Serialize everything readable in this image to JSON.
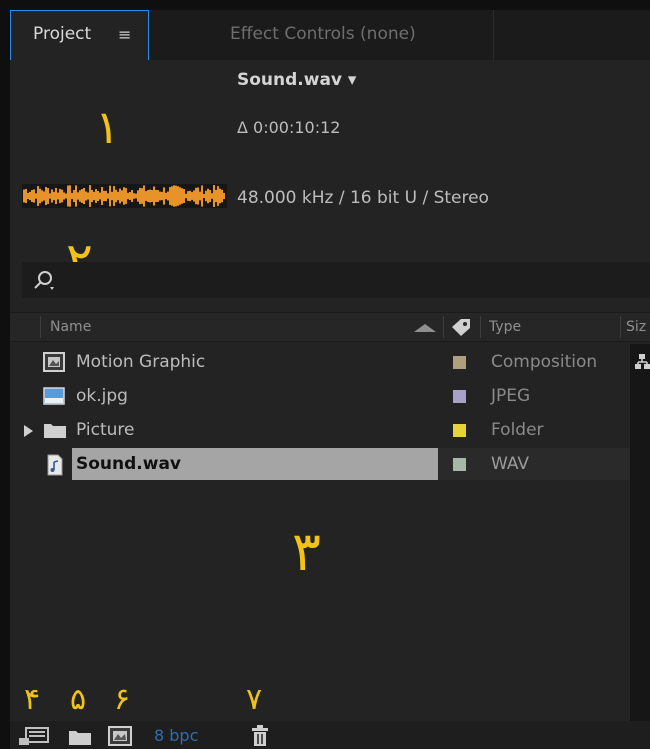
{
  "tabs": {
    "project_label": "Project",
    "menu_glyph": "≡",
    "effect_controls_label": "Effect Controls (none)"
  },
  "preview": {
    "file_title": "Sound.wav ▾",
    "duration": "Δ 0:00:10:12",
    "audio_info": "48.000 kHz / 16 bit U / Stereo",
    "waveform_color": "#e8922a"
  },
  "annotations": {
    "n1": "١",
    "n2": "۲",
    "n3": "۳",
    "n4": "۴",
    "n5": "۵",
    "n6": "۶",
    "n7": "۷",
    "color": "#f2c317"
  },
  "search": {
    "icon": "search-icon"
  },
  "columns": {
    "name": "Name",
    "type": "Type",
    "size": "Siz"
  },
  "items": [
    {
      "name": "Motion Graphic",
      "type": "Composition",
      "icon": "composition-icon",
      "label_color": "#b09f7d"
    },
    {
      "name": "ok.jpg",
      "type": "JPEG",
      "icon": "image-icon",
      "label_color": "#a9a2c8"
    },
    {
      "name": "Picture",
      "type": "Folder",
      "icon": "folder-icon",
      "label_color": "#e6d23a"
    },
    {
      "name": "Sound.wav",
      "type": "WAV",
      "icon": "audio-file-icon",
      "label_color": "#a6b8a8",
      "selected": true
    }
  ],
  "bottom": {
    "bpc": "8 bpc",
    "icons": [
      "interpret-footage-icon",
      "new-folder-icon",
      "new-composition-icon",
      "trash-icon"
    ]
  }
}
